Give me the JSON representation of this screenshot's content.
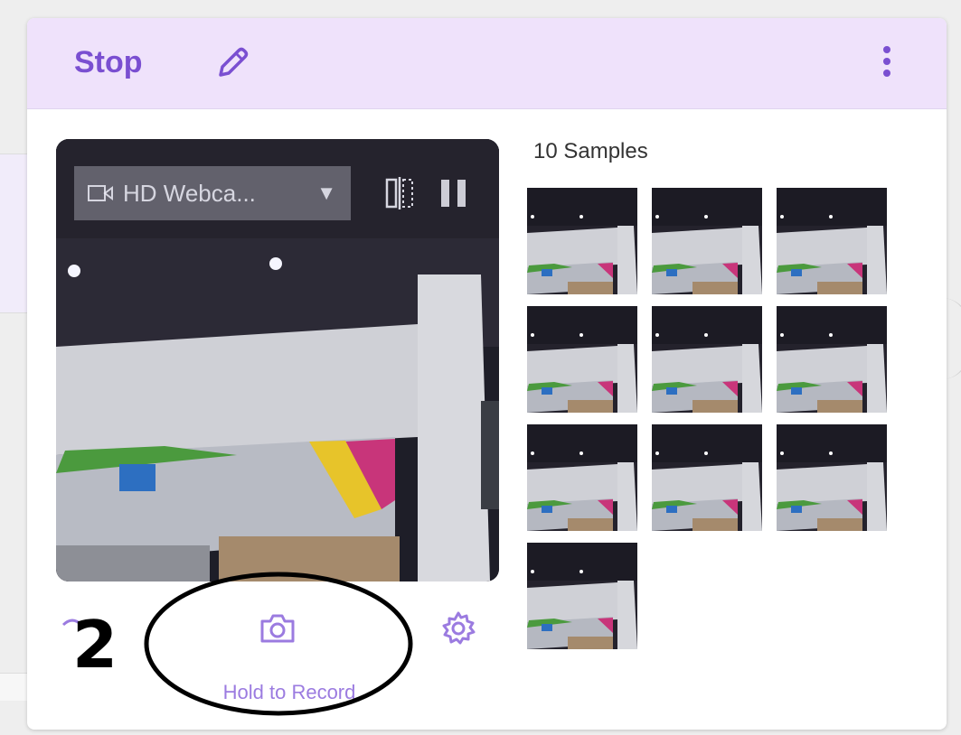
{
  "class_card": {
    "name": "Stop",
    "edit_icon": "pencil-icon",
    "menu_icon": "kebab-icon"
  },
  "webcam": {
    "device_label": "HD Webca...",
    "device_icon": "video-camera-icon",
    "dropdown_icon": "triangle-down-icon",
    "flip_icon": "flip-icon",
    "pause_icon": "pause-icon",
    "record_label": "Hold to Record",
    "record_icon": "camera-icon",
    "settings_icon": "gear-icon"
  },
  "annotation": {
    "number": "2"
  },
  "samples": {
    "title": "10 Samples",
    "count": 10
  }
}
